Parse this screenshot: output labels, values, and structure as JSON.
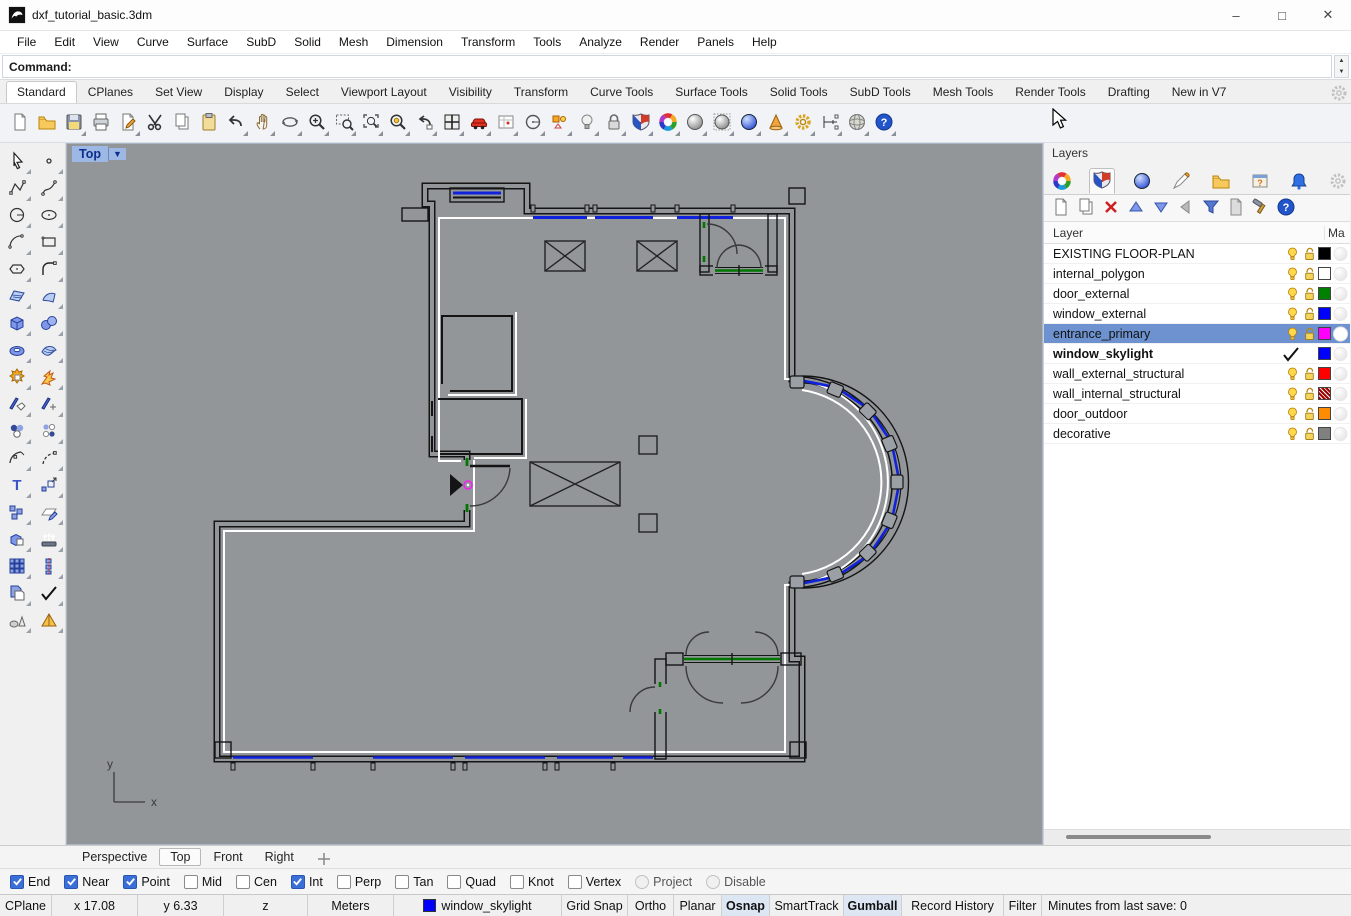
{
  "window": {
    "title": "dxf_tutorial_basic.3dm",
    "controls": [
      "minimize",
      "maximize",
      "close"
    ]
  },
  "menubar": {
    "items": [
      "File",
      "Edit",
      "View",
      "Curve",
      "Surface",
      "SubD",
      "Solid",
      "Mesh",
      "Dimension",
      "Transform",
      "Tools",
      "Analyze",
      "Render",
      "Panels",
      "Help"
    ]
  },
  "command": {
    "label": "Command:",
    "value": ""
  },
  "tabbar": {
    "active": "Standard",
    "tabs": [
      "Standard",
      "CPlanes",
      "Set View",
      "Display",
      "Select",
      "Viewport Layout",
      "Visibility",
      "Transform",
      "Curve Tools",
      "Surface Tools",
      "Solid Tools",
      "SubD Tools",
      "Mesh Tools",
      "Render Tools",
      "Drafting",
      "New in V7"
    ]
  },
  "toolbar": {
    "buttons": [
      {
        "name": "new-file",
        "icon": "doc",
        "fly": false
      },
      {
        "name": "open-file",
        "icon": "folder",
        "fly": false
      },
      {
        "name": "save-file",
        "icon": "save",
        "fly": true
      },
      {
        "name": "print",
        "icon": "print",
        "fly": false
      },
      {
        "name": "export",
        "icon": "doc-export",
        "fly": true
      },
      {
        "name": "cut",
        "icon": "scissors",
        "fly": false
      },
      {
        "name": "copy",
        "icon": "doc-copy",
        "fly": false
      },
      {
        "name": "paste",
        "icon": "clipboard",
        "fly": false
      },
      {
        "name": "undo",
        "icon": "undo",
        "fly": true
      },
      {
        "name": "pan",
        "icon": "hand",
        "fly": true
      },
      {
        "name": "rotate-view",
        "icon": "rotate",
        "fly": true
      },
      {
        "name": "zoom-dynamic",
        "icon": "mag-plus",
        "fly": true
      },
      {
        "name": "zoom-window",
        "icon": "mag-dash",
        "fly": true
      },
      {
        "name": "zoom-extents",
        "icon": "mag-rect",
        "fly": true
      },
      {
        "name": "zoom-selected",
        "icon": "mag-dot",
        "fly": true
      },
      {
        "name": "undo-view-change",
        "icon": "undo-view",
        "fly": true
      },
      {
        "name": "viewport-layout",
        "icon": "grid4",
        "fly": true
      },
      {
        "name": "named-views",
        "icon": "car",
        "fly": true
      },
      {
        "name": "set-cplane",
        "icon": "map",
        "fly": true
      },
      {
        "name": "object-snap",
        "icon": "circle-tool",
        "fly": true
      },
      {
        "name": "selection-filter",
        "icon": "select",
        "fly": true
      },
      {
        "name": "hide-objects",
        "icon": "bulb",
        "fly": true
      },
      {
        "name": "lock-objects",
        "icon": "lock",
        "fly": true
      },
      {
        "name": "edit-layers",
        "icon": "shield",
        "fly": true
      },
      {
        "name": "object-properties",
        "icon": "wheel",
        "fly": true
      },
      {
        "name": "shaded-viewport",
        "icon": "sphere-gray",
        "fly": true
      },
      {
        "name": "ghosted-viewport",
        "icon": "sphere-dot",
        "fly": true
      },
      {
        "name": "rendered-viewport",
        "icon": "sphere-blue",
        "fly": true
      },
      {
        "name": "render-plugin",
        "icon": "cone",
        "fly": true
      },
      {
        "name": "options",
        "icon": "gears",
        "fly": true
      },
      {
        "name": "dimension",
        "icon": "dim",
        "fly": true
      },
      {
        "name": "earth-anchor",
        "icon": "globe",
        "fly": true
      },
      {
        "name": "help",
        "icon": "help",
        "fly": true
      }
    ]
  },
  "left_toolbar": {
    "icons": [
      "pointer",
      "point",
      "polyline",
      "curve",
      "circle",
      "ellipse",
      "arc",
      "rectangle",
      "polygon",
      "fillet",
      "srf-grid",
      "srf-bend",
      "box",
      "spheres",
      "torus",
      "srf-quilt",
      "puzzle",
      "explode",
      "trim",
      "split",
      "paint",
      "paint2",
      "adjust-arc",
      "adjust-arc2",
      "text",
      "scale",
      "blocks",
      "plane-pencil",
      "solid",
      "extrude",
      "array",
      "array-v",
      "vis",
      "check2",
      "meshes",
      "pyramid"
    ]
  },
  "viewport": {
    "label": "Top",
    "axis": {
      "x": "x",
      "y": "y"
    }
  },
  "layers_panel": {
    "title": "Layers",
    "tabs": [
      {
        "name": "properties-tab",
        "icon": "wheel",
        "active": false
      },
      {
        "name": "layers-tab",
        "icon": "shield",
        "active": true
      },
      {
        "name": "rendering-tab",
        "icon": "sphere-blue",
        "active": false
      },
      {
        "name": "materials-tab",
        "icon": "chisel",
        "active": false
      },
      {
        "name": "libraries-tab",
        "icon": "folder",
        "active": false
      },
      {
        "name": "help-tab",
        "icon": "help-win",
        "active": false
      },
      {
        "name": "notifications-tab",
        "icon": "bell",
        "active": false
      },
      {
        "name": "panel-options-tab",
        "icon": "gear-flat",
        "active": false
      }
    ],
    "toolbar": [
      {
        "name": "new-layer",
        "icon": "doc"
      },
      {
        "name": "new-sublayer",
        "icon": "doc-copy"
      },
      {
        "name": "delete-layer",
        "icon": "x-red"
      },
      {
        "name": "move-layer-up",
        "icon": "tri-up"
      },
      {
        "name": "move-layer-down",
        "icon": "tri-down"
      },
      {
        "name": "match-layer",
        "icon": "tri-left"
      },
      {
        "name": "filter-layers",
        "icon": "funnel"
      },
      {
        "name": "layer-settings",
        "icon": "doc-gray"
      },
      {
        "name": "layer-tools",
        "icon": "hammer"
      },
      {
        "name": "layer-help",
        "icon": "help"
      }
    ],
    "columns": {
      "layer": "Layer",
      "material": "Ma"
    },
    "rows": [
      {
        "name": "EXISTING FLOOR-PLAN",
        "color": "#000000",
        "bulb": true,
        "lock": true,
        "selected": false,
        "current": false,
        "bold": false,
        "pattern": false
      },
      {
        "name": "internal_polygon",
        "color": "#ffffff",
        "bulb": true,
        "lock": true,
        "selected": false,
        "current": false,
        "bold": false,
        "pattern": false
      },
      {
        "name": "door_external",
        "color": "#008000",
        "bulb": true,
        "lock": true,
        "selected": false,
        "current": false,
        "bold": false,
        "pattern": false
      },
      {
        "name": "window_external",
        "color": "#0000ff",
        "bulb": true,
        "lock": true,
        "selected": false,
        "current": false,
        "bold": false,
        "pattern": false
      },
      {
        "name": "entrance_primary",
        "color": "#ff00ff",
        "bulb": true,
        "lock": true,
        "selected": true,
        "current": false,
        "bold": false,
        "pattern": false
      },
      {
        "name": "window_skylight",
        "color": "#0000ff",
        "bulb": false,
        "lock": false,
        "selected": false,
        "current": true,
        "bold": true,
        "pattern": false
      },
      {
        "name": "wall_external_structural",
        "color": "#ff0000",
        "bulb": true,
        "lock": true,
        "selected": false,
        "current": false,
        "bold": false,
        "pattern": false
      },
      {
        "name": "wall_internal_structural",
        "color": "#aa0000",
        "bulb": true,
        "lock": true,
        "selected": false,
        "current": false,
        "bold": false,
        "pattern": true
      },
      {
        "name": "door_outdoor",
        "color": "#ff8c00",
        "bulb": true,
        "lock": true,
        "selected": false,
        "current": false,
        "bold": false,
        "pattern": false
      },
      {
        "name": "decorative",
        "color": "#808080",
        "bulb": true,
        "lock": true,
        "selected": false,
        "current": false,
        "bold": false,
        "pattern": false
      }
    ]
  },
  "viewport_tabs": {
    "active": "Top",
    "tabs": [
      "Perspective",
      "Top",
      "Front",
      "Right"
    ]
  },
  "osnap": {
    "items": [
      {
        "label": "End",
        "checked": true,
        "muted": false
      },
      {
        "label": "Near",
        "checked": true,
        "muted": false
      },
      {
        "label": "Point",
        "checked": true,
        "muted": false
      },
      {
        "label": "Mid",
        "checked": false,
        "muted": false
      },
      {
        "label": "Cen",
        "checked": false,
        "muted": false
      },
      {
        "label": "Int",
        "checked": true,
        "muted": false
      },
      {
        "label": "Perp",
        "checked": false,
        "muted": false
      },
      {
        "label": "Tan",
        "checked": false,
        "muted": false
      },
      {
        "label": "Quad",
        "checked": false,
        "muted": false
      },
      {
        "label": "Knot",
        "checked": false,
        "muted": false
      },
      {
        "label": "Vertex",
        "checked": false,
        "muted": false
      },
      {
        "label": "Project",
        "checked": false,
        "muted": true
      },
      {
        "label": "Disable",
        "checked": false,
        "muted": true
      }
    ]
  },
  "statusbar": {
    "cells": [
      {
        "label": "CPlane"
      },
      {
        "label": "x 17.08"
      },
      {
        "label": "y 6.33"
      },
      {
        "label": "z"
      },
      {
        "label": "Meters"
      },
      {
        "label": "window_skylight",
        "swatch": "#0000ff"
      },
      {
        "label": "Grid Snap"
      },
      {
        "label": "Ortho"
      },
      {
        "label": "Planar"
      },
      {
        "label": "Osnap",
        "active": true
      },
      {
        "label": "SmartTrack"
      },
      {
        "label": "Gumball",
        "active": true
      },
      {
        "label": "Record History"
      },
      {
        "label": "Filter"
      },
      {
        "label": "Minutes from last save: 0",
        "grow": true
      }
    ]
  },
  "colors": {
    "viewport_bg": "#929699",
    "wall": "#141414",
    "interior_white": "#ffffff",
    "window_blue": "#0000dd",
    "door_green": "#007700",
    "entrance_magenta": "#ee22ee",
    "selection_row": "#6d92cf",
    "checked_checkbox": "#3a6fd8"
  }
}
